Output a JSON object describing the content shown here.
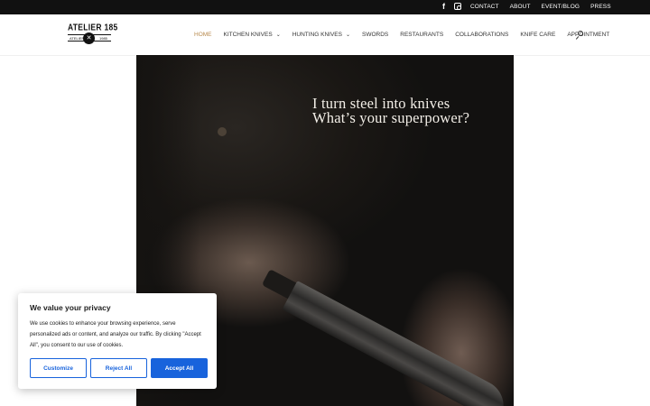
{
  "topbar": {
    "social": {
      "facebook_icon": "f",
      "instagram_icon": "instagram-icon"
    },
    "links": [
      "CONTACT",
      "ABOUT",
      "EVENT/BLOG",
      "PRESS"
    ]
  },
  "header": {
    "logo": {
      "brand": "ATELIER 185",
      "left": "ATELIER",
      "right": "1985",
      "mark": "✕"
    },
    "nav": [
      {
        "label": "HOME",
        "active": true,
        "dropdown": false
      },
      {
        "label": "KITCHEN KNIVES",
        "active": false,
        "dropdown": true
      },
      {
        "label": "HUNTING KNIVES",
        "active": false,
        "dropdown": true
      },
      {
        "label": "SWORDS",
        "active": false,
        "dropdown": false
      },
      {
        "label": "RESTAURANTS",
        "active": false,
        "dropdown": false
      },
      {
        "label": "COLLABORATIONS",
        "active": false,
        "dropdown": false
      },
      {
        "label": "KNIFE CARE",
        "active": false,
        "dropdown": false
      },
      {
        "label": "APPOINTMENT",
        "active": false,
        "dropdown": false
      }
    ],
    "active_color": "#b88a4e"
  },
  "hero": {
    "tagline_line1": "I turn steel into knives",
    "tagline_line2": "What’s your superpower?"
  },
  "cookie": {
    "title": "We value your privacy",
    "body": "We use cookies to enhance your browsing experience, serve personalized ads or content, and analyze our traffic. By clicking \"Accept All\", you consent to our use of cookies.",
    "customize": "Customize",
    "reject": "Reject All",
    "accept": "Accept All",
    "accent": "#1863dc"
  }
}
